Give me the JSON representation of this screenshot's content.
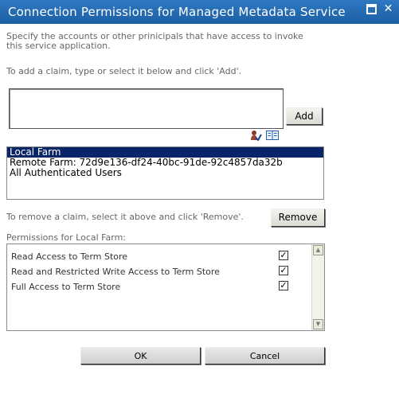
{
  "dialog": {
    "title": "Connection Permissions for Managed Metadata Service",
    "maximize_icon": "maximize-icon",
    "close_icon": "close-icon",
    "close_glyph": "✕"
  },
  "intro": {
    "line1": "Specify the accounts or other prinicipals that have access to invoke",
    "line2": "this service application.",
    "add_instruction": "To add a claim, type or select it below and click 'Add'."
  },
  "claim_input": {
    "value": ""
  },
  "add_button": {
    "label": "Add"
  },
  "picker_icons": {
    "check_names": "people-check-icon",
    "browse": "address-book-icon"
  },
  "claims": {
    "items": [
      {
        "label": "Local Farm",
        "selected": true
      },
      {
        "label": "Remote Farm: 72d9e136-df24-40bc-91de-92c4857da32b",
        "selected": false
      },
      {
        "label": "All Authenticated Users",
        "selected": false
      }
    ]
  },
  "remove": {
    "instruction": "To remove a claim, select it above and click 'Remove'.",
    "button_label": "Remove"
  },
  "permissions": {
    "heading": "Permissions for Local Farm:",
    "items": [
      {
        "label": "Read Access to Term Store",
        "checked": true
      },
      {
        "label": "Read and Restricted Write Access to Term Store",
        "checked": true
      },
      {
        "label": "Full Access to Term Store",
        "checked": true
      }
    ],
    "check_glyph": "✓",
    "scroll_up_glyph": "▲",
    "scroll_down_glyph": "▼"
  },
  "footer": {
    "ok_label": "OK",
    "cancel_label": "Cancel"
  },
  "colors": {
    "titlebar": "#1d5fa3",
    "selection": "#0a246a"
  }
}
